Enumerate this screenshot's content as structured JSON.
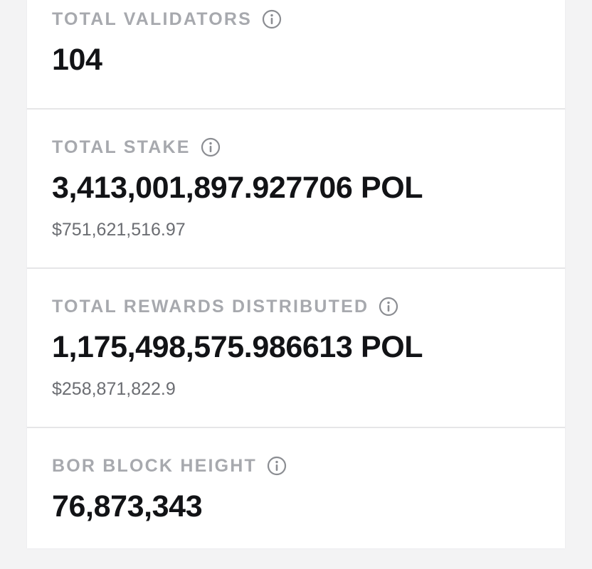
{
  "stats": [
    {
      "label": "TOTAL VALIDATORS",
      "info_icon": "info-circle-icon",
      "value": "104"
    },
    {
      "label": "TOTAL STAKE",
      "info_icon": "info-circle-icon",
      "value": "3,413,001,897.927706 POL",
      "usd": "$751,621,516.97"
    },
    {
      "label": "TOTAL REWARDS DISTRIBUTED",
      "info_icon": "info-circle-icon",
      "value": "1,175,498,575.986613 POL",
      "usd": "$258,871,822.9"
    },
    {
      "label": "BOR BLOCK HEIGHT",
      "info_icon": "info-circle-icon",
      "value": "76,873,343"
    }
  ],
  "colors": {
    "background": "#f3f3f4",
    "panel": "#ffffff",
    "label": "#a7a9ae",
    "value": "#121316",
    "usd": "#6b6d72",
    "divider": "#e6e6e8"
  }
}
